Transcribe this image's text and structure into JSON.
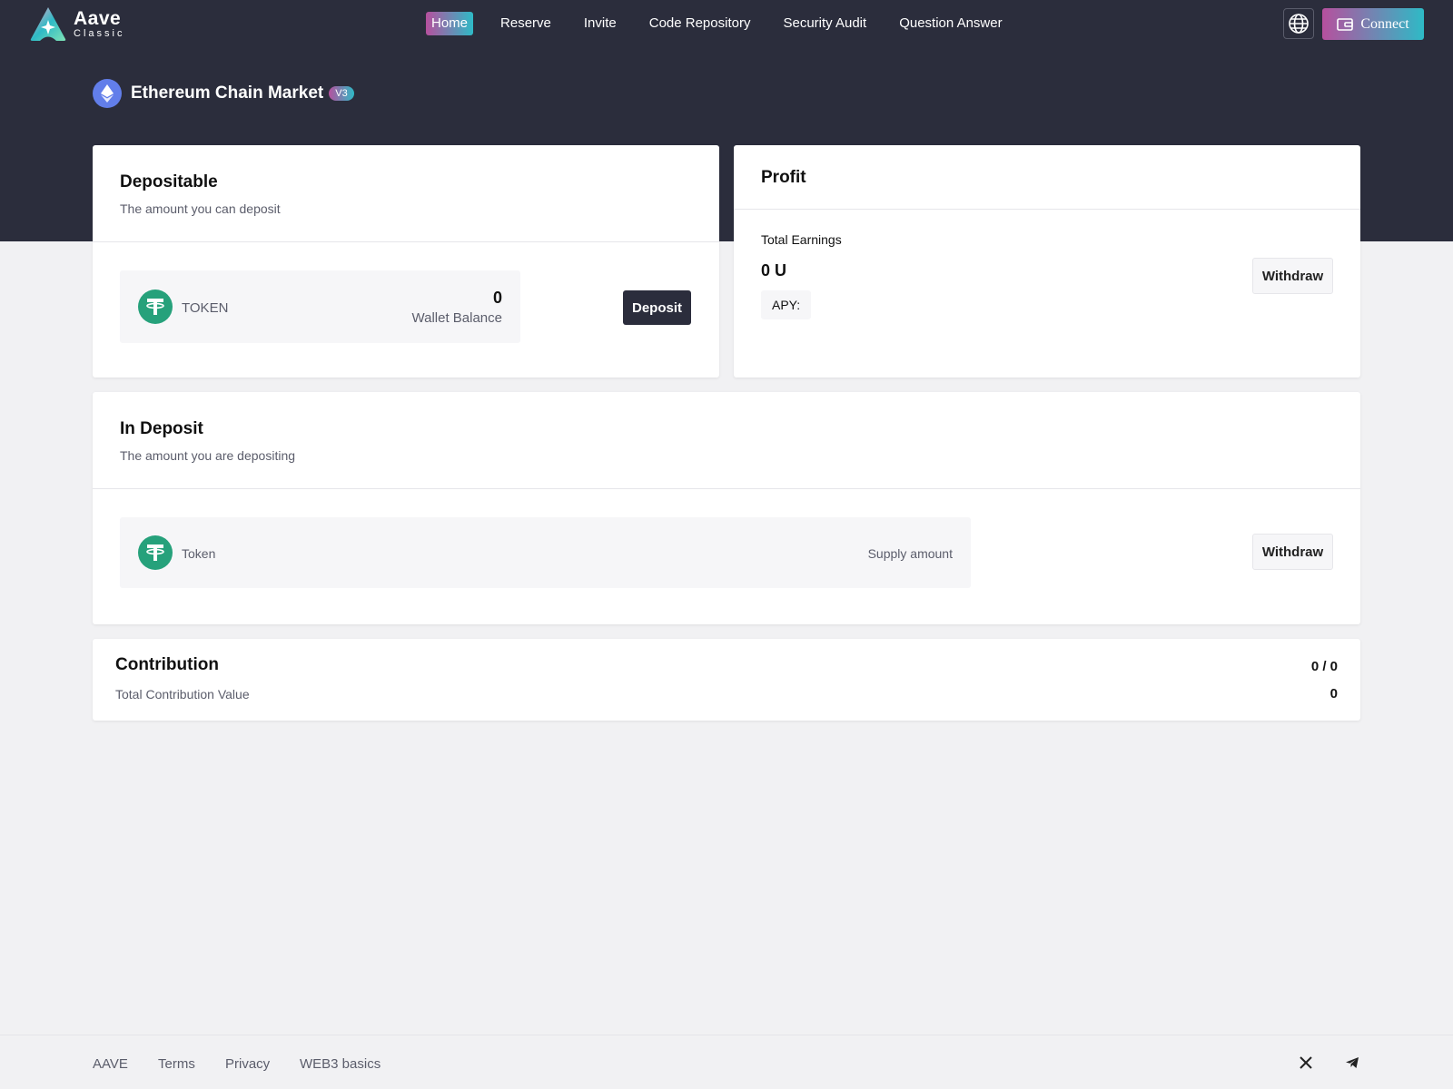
{
  "brand": {
    "name": "Aave",
    "sub": "Classic"
  },
  "nav": {
    "items": [
      {
        "label": "Home",
        "active": true
      },
      {
        "label": "Reserve"
      },
      {
        "label": "Invite"
      },
      {
        "label": "Code Repository"
      },
      {
        "label": "Security Audit"
      },
      {
        "label": "Question Answer"
      }
    ]
  },
  "header": {
    "connect_label": "Connect",
    "globe_icon": "globe-icon"
  },
  "market": {
    "title": "Ethereum Chain Market",
    "badge": "V3"
  },
  "depositable": {
    "title": "Depositable",
    "subtitle": "The amount you can deposit",
    "token": "TOKEN",
    "balance_value": "0",
    "balance_label": "Wallet Balance",
    "deposit_label": "Deposit"
  },
  "profit": {
    "title": "Profit",
    "total_label": "Total Earnings",
    "total_value": "0 U",
    "apy_label": "APY:",
    "withdraw_label": "Withdraw"
  },
  "in_deposit": {
    "title": "In Deposit",
    "subtitle": "The amount you are depositing",
    "token": "Token",
    "supply_label": "Supply amount",
    "withdraw_label": "Withdraw"
  },
  "contribution": {
    "title": "Contribution",
    "ratio": "0 / 0",
    "total_label": "Total Contribution Value",
    "total_value": "0"
  },
  "footer": {
    "links": [
      "AAVE",
      "Terms",
      "Privacy",
      "WEB3 basics"
    ],
    "icons": [
      "x-icon",
      "telegram-icon"
    ]
  },
  "colors": {
    "hero_bg": "#2b2d3c",
    "accent_start": "#b6509e",
    "accent_end": "#2ebac6",
    "usdt_green": "#26a17b",
    "eth_blue": "#627eea"
  }
}
